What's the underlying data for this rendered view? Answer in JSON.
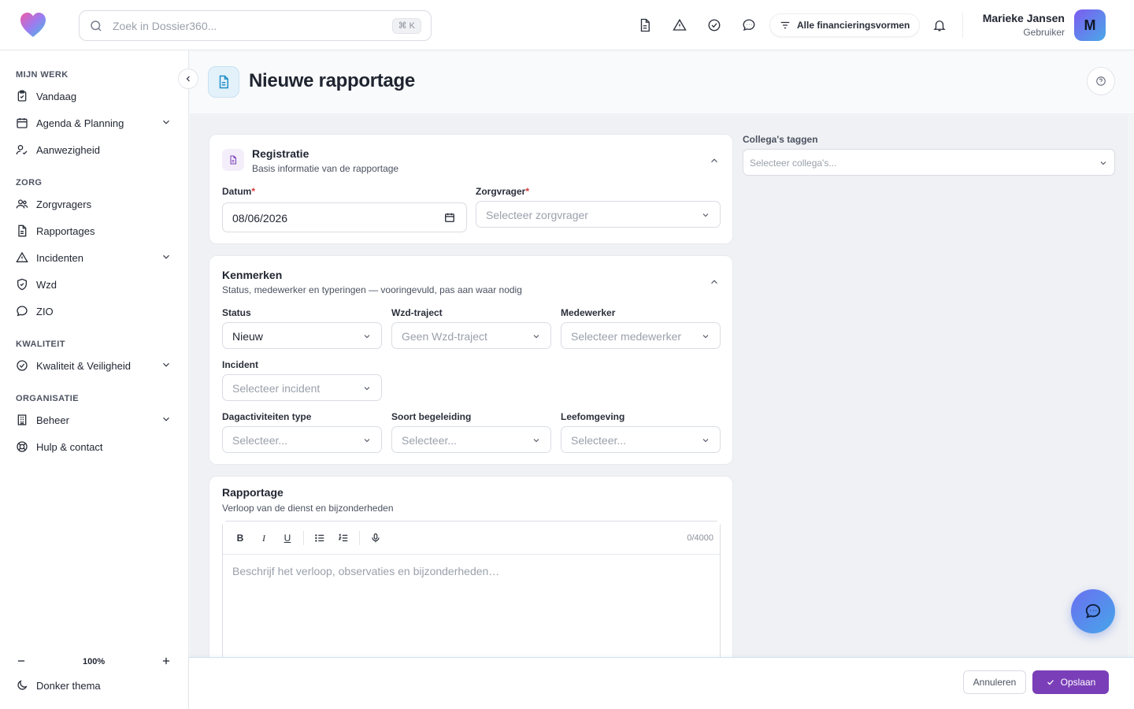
{
  "app": {
    "name": "Dossier360"
  },
  "search": {
    "placeholder": "Zoek in Dossier360...",
    "shortcut": "⌘ K"
  },
  "topbar": {
    "icons": [
      "document-icon",
      "warning-icon",
      "check-circle-icon",
      "chat-icon"
    ],
    "financing_filter": "Alle financieringsvormen"
  },
  "user": {
    "name": "Marieke Jansen",
    "role": "Gebruiker",
    "initial": "M"
  },
  "sidebar": {
    "sections": [
      {
        "title": "MIJN WERK"
      },
      {
        "title": "ZORG"
      },
      {
        "title": "KWALITEIT"
      },
      {
        "title": "ORGANISATIE"
      }
    ],
    "items": [
      {
        "label": "Vandaag",
        "icon": "clipboard-icon"
      },
      {
        "label": "Agenda & Planning",
        "icon": "calendar-icon",
        "expandable": true
      },
      {
        "label": "Aanwezigheid",
        "icon": "user-check-icon"
      },
      {
        "label": "Zorgvragers",
        "icon": "users-icon"
      },
      {
        "label": "Rapportages",
        "icon": "document-icon"
      },
      {
        "label": "Incidenten",
        "icon": "warning-icon",
        "expandable": true
      },
      {
        "label": "Wzd",
        "icon": "shield-icon"
      },
      {
        "label": "ZIO",
        "icon": "chat-icon"
      },
      {
        "label": "Kwaliteit & Veiligheid",
        "icon": "check-circle-icon",
        "expandable": true
      },
      {
        "label": "Beheer",
        "icon": "building-icon",
        "expandable": true
      },
      {
        "label": "Hulp & contact",
        "icon": "lifebuoy-icon"
      }
    ],
    "zoom": "100%",
    "theme_toggle": "Donker thema"
  },
  "page": {
    "title": "Nieuwe rapportage"
  },
  "registratie": {
    "title": "Registratie",
    "subtitle": "Basis informatie van de rapportage",
    "datum_label": "Datum",
    "datum_value": "08/06/2026",
    "zorgvrager_label": "Zorgvrager",
    "zorgvrager_placeholder": "Selecteer zorgvrager"
  },
  "kenmerken": {
    "title": "Kenmerken",
    "subtitle": "Status, medewerker en typeringen — vooringevuld, pas aan waar nodig",
    "status_label": "Status",
    "status_value": "Nieuw",
    "wzd_label": "Wzd-traject",
    "wzd_placeholder": "Geen Wzd-traject",
    "medewerker_label": "Medewerker",
    "medewerker_placeholder": "Selecteer medewerker",
    "incident_label": "Incident",
    "incident_placeholder": "Selecteer incident",
    "dagactiviteiten_label": "Dagactiviteiten type",
    "begeleiding_label": "Soort begeleiding",
    "leefomgeving_label": "Leefomgeving",
    "generic_placeholder": "Selecteer..."
  },
  "rapportage": {
    "title": "Rapportage",
    "subtitle": "Verloop van de dienst en bijzonderheden",
    "toolbar": {
      "bold": "B",
      "italic": "I",
      "underline": "U"
    },
    "char_count": "0/4000",
    "placeholder": "Beschrijf het verloop, observaties en bijzonderheden…"
  },
  "tagging": {
    "label": "Collega's taggen",
    "placeholder": "Selecteer collega's..."
  },
  "actions": {
    "cancel": "Annuleren",
    "save": "Opslaan"
  },
  "colors": {
    "accent": "#7a3fb8",
    "required": "#d63a3a",
    "brand_gradient_start": "#7c5cf0",
    "brand_gradient_end": "#4aa8e8"
  }
}
